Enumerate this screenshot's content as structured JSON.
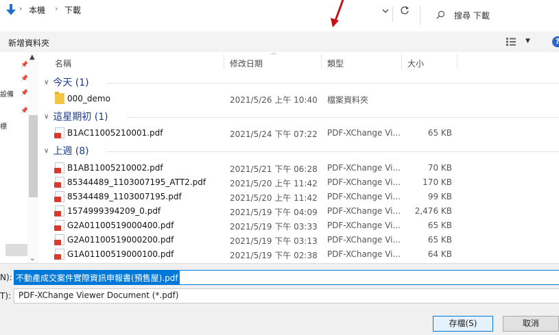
{
  "address_bar": {
    "crumbs": [
      "本機",
      "下載"
    ],
    "search_placeholder": "搜尋 下載"
  },
  "toolbar": {
    "new_folder": "新增資料夾",
    "help": "?"
  },
  "nav_pane": {
    "labels": [
      "設備",
      "標"
    ]
  },
  "columns": {
    "name": "名稱",
    "date": "修改日期",
    "type": "類型",
    "size": "大小"
  },
  "groups": [
    {
      "title": "今天 (1)",
      "files": [
        {
          "name": "000_demo",
          "date": "2021/5/26 上午 10:40",
          "type": "檔案資料夾",
          "size": "",
          "kind": "folder"
        }
      ]
    },
    {
      "title": "這星期初 (1)",
      "files": [
        {
          "name": "B1AC11005210001.pdf",
          "date": "2021/5/24 下午 07:22",
          "type": "PDF-XChange Vi...",
          "size": "65 KB",
          "kind": "pdf"
        }
      ]
    },
    {
      "title": "上週 (8)",
      "files": [
        {
          "name": "B1AB11005210002.pdf",
          "date": "2021/5/21 下午 06:28",
          "type": "PDF-XChange Vi...",
          "size": "70 KB",
          "kind": "pdf"
        },
        {
          "name": "85344489_1103007195_ATT2.pdf",
          "date": "2021/5/20 上午 11:42",
          "type": "PDF-XChange Vi...",
          "size": "170 KB",
          "kind": "pdf"
        },
        {
          "name": "85344489_1103007195.pdf",
          "date": "2021/5/20 上午 11:42",
          "type": "PDF-XChange Vi...",
          "size": "99 KB",
          "kind": "pdf"
        },
        {
          "name": "1574999394209_0.pdf",
          "date": "2021/5/19 下午 04:09",
          "type": "PDF-XChange Vi...",
          "size": "2,476 KB",
          "kind": "pdf"
        },
        {
          "name": "G2A01100519000400.pdf",
          "date": "2021/5/19 下午 03:33",
          "type": "PDF-XChange Vi...",
          "size": "65 KB",
          "kind": "pdf"
        },
        {
          "name": "G2A01100519000200.pdf",
          "date": "2021/5/19 下午 03:13",
          "type": "PDF-XChange Vi...",
          "size": "65 KB",
          "kind": "pdf"
        },
        {
          "name": "G1A01100519000100.pdf",
          "date": "2021/5/19 下午 02:38",
          "type": "PDF-XChange Vi...",
          "size": "64 KB",
          "kind": "pdf"
        }
      ]
    }
  ],
  "bottom": {
    "filename_label": "N):",
    "filename_value": "不動產成交案件實際資訊申報書(預售屋).pdf",
    "filetype_label": "T):",
    "filetype_value": "PDF-XChange Viewer Document (*.pdf)",
    "save_label": "存檔(S)",
    "cancel_label": "取消"
  },
  "colors": {
    "accent": "#0078d7",
    "group_header": "#1a3a8c",
    "annotation_arrow": "#c0141a"
  }
}
